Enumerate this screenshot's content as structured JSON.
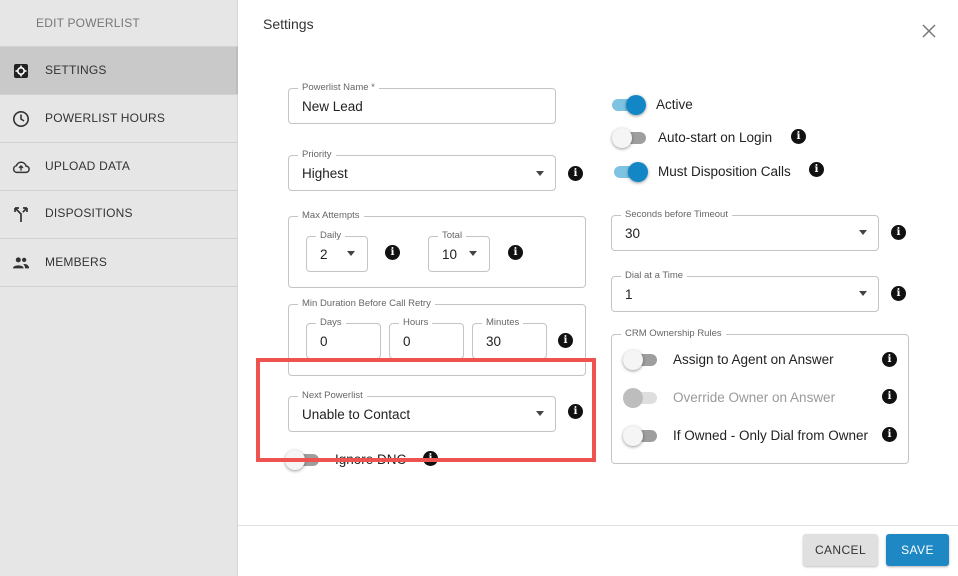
{
  "sidebar": {
    "title": "EDIT POWERLIST",
    "items": [
      {
        "label": "SETTINGS",
        "icon": "gear-icon"
      },
      {
        "label": "POWERLIST HOURS",
        "icon": "clock-icon"
      },
      {
        "label": "UPLOAD DATA",
        "icon": "cloud-upload-icon"
      },
      {
        "label": "DISPOSITIONS",
        "icon": "fork-icon"
      },
      {
        "label": "MEMBERS",
        "icon": "people-icon"
      }
    ],
    "active_item": "SETTINGS"
  },
  "dialog": {
    "title": "Settings",
    "close_icon": "close-icon"
  },
  "form": {
    "powerlist_name": {
      "label": "Powerlist Name *",
      "value": "New Lead"
    },
    "priority": {
      "label": "Priority",
      "value": "Highest"
    },
    "max_attempts": {
      "label": "Max Attempts",
      "daily": {
        "label": "Daily",
        "value": "2"
      },
      "total": {
        "label": "Total",
        "value": "10"
      }
    },
    "min_duration": {
      "label": "Min Duration Before Call Retry",
      "days": {
        "label": "Days",
        "value": "0"
      },
      "hours": {
        "label": "Hours",
        "value": "0"
      },
      "minutes": {
        "label": "Minutes",
        "value": "30"
      }
    },
    "next_powerlist": {
      "label": "Next Powerlist",
      "value": "Unable to Contact"
    },
    "ignore_dnc": {
      "label": "Ignore DNC",
      "on": false
    },
    "active": {
      "label": "Active",
      "on": true
    },
    "auto_start": {
      "label": "Auto-start on Login",
      "on": false
    },
    "must_disposition": {
      "label": "Must Disposition Calls",
      "on": true
    },
    "seconds_timeout": {
      "label": "Seconds before Timeout",
      "value": "30"
    },
    "dial_at_time": {
      "label": "Dial at a Time",
      "value": "1"
    },
    "crm_rules": {
      "label": "CRM Ownership Rules",
      "assign_agent": {
        "label": "Assign to Agent on Answer",
        "on": false
      },
      "override_owner": {
        "label": "Override Owner on Answer",
        "on": false,
        "disabled": true
      },
      "if_owned": {
        "label": "If Owned - Only Dial from Owner",
        "on": false
      }
    }
  },
  "footer": {
    "cancel_label": "CANCEL",
    "save_label": "SAVE"
  },
  "colors": {
    "accent": "#1387c5",
    "highlight_box": "#ef5350",
    "sidebar_bg": "#e6e6e6",
    "sidebar_active": "#c9c9c9"
  }
}
